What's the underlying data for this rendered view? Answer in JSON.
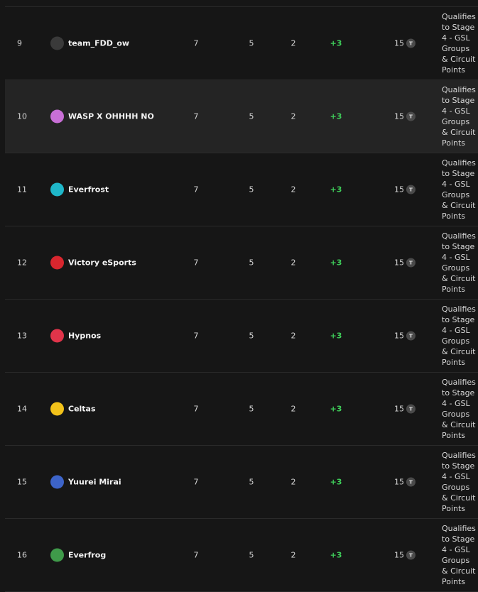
{
  "standings": [
    {
      "rank": "9",
      "team": "team_FDD_ow",
      "logo_icon": "team-fdd-logo",
      "logo_color": "#3a3a3a",
      "played": "7",
      "wins": "5",
      "losses": "2",
      "diff": "+3",
      "points": "15",
      "points_badge": "T",
      "outcome": "Qualifies to Stage 4 - GSL Groups & Circuit Points",
      "highlighted": false
    },
    {
      "rank": "10",
      "team": "WASP X OHHHH NO",
      "logo_icon": "wasp-logo",
      "logo_color": "#c86fd6",
      "played": "7",
      "wins": "5",
      "losses": "2",
      "diff": "+3",
      "points": "15",
      "points_badge": "T",
      "outcome": "Qualifies to Stage 4 - GSL Groups & Circuit Points",
      "highlighted": true
    },
    {
      "rank": "11",
      "team": "Everfrost",
      "logo_icon": "everfrost-logo",
      "logo_color": "#1fb7c9",
      "played": "7",
      "wins": "5",
      "losses": "2",
      "diff": "+3",
      "points": "15",
      "points_badge": "T",
      "outcome": "Qualifies to Stage 4 - GSL Groups & Circuit Points",
      "highlighted": false
    },
    {
      "rank": "12",
      "team": "Victory eSports",
      "logo_icon": "victory-logo",
      "logo_color": "#d8262e",
      "played": "7",
      "wins": "5",
      "losses": "2",
      "diff": "+3",
      "points": "15",
      "points_badge": "T",
      "outcome": "Qualifies to Stage 4 - GSL Groups & Circuit Points",
      "highlighted": false
    },
    {
      "rank": "13",
      "team": "Hypnos",
      "logo_icon": "hypnos-logo",
      "logo_color": "#e0344a",
      "played": "7",
      "wins": "5",
      "losses": "2",
      "diff": "+3",
      "points": "15",
      "points_badge": "T",
      "outcome": "Qualifies to Stage 4 - GSL Groups & Circuit Points",
      "highlighted": false
    },
    {
      "rank": "14",
      "team": "Celtas",
      "logo_icon": "celtas-logo",
      "logo_color": "#f2c21a",
      "played": "7",
      "wins": "5",
      "losses": "2",
      "diff": "+3",
      "points": "15",
      "points_badge": "T",
      "outcome": "Qualifies to Stage 4 - GSL Groups & Circuit Points",
      "highlighted": false
    },
    {
      "rank": "15",
      "team": "Yuurei Mirai",
      "logo_icon": "yuurei-mirai-logo",
      "logo_color": "#3d64c9",
      "played": "7",
      "wins": "5",
      "losses": "2",
      "diff": "+3",
      "points": "15",
      "points_badge": "T",
      "outcome": "Qualifies to Stage 4 - GSL Groups & Circuit Points",
      "highlighted": false
    },
    {
      "rank": "16",
      "team": "Everfrog",
      "logo_icon": "everfrog-logo",
      "logo_color": "#3f9a4a",
      "played": "7",
      "wins": "5",
      "losses": "2",
      "diff": "+3",
      "points": "15",
      "points_badge": "T",
      "outcome": "Qualifies to Stage 4 - GSL Groups & Circuit Points",
      "highlighted": false
    }
  ]
}
